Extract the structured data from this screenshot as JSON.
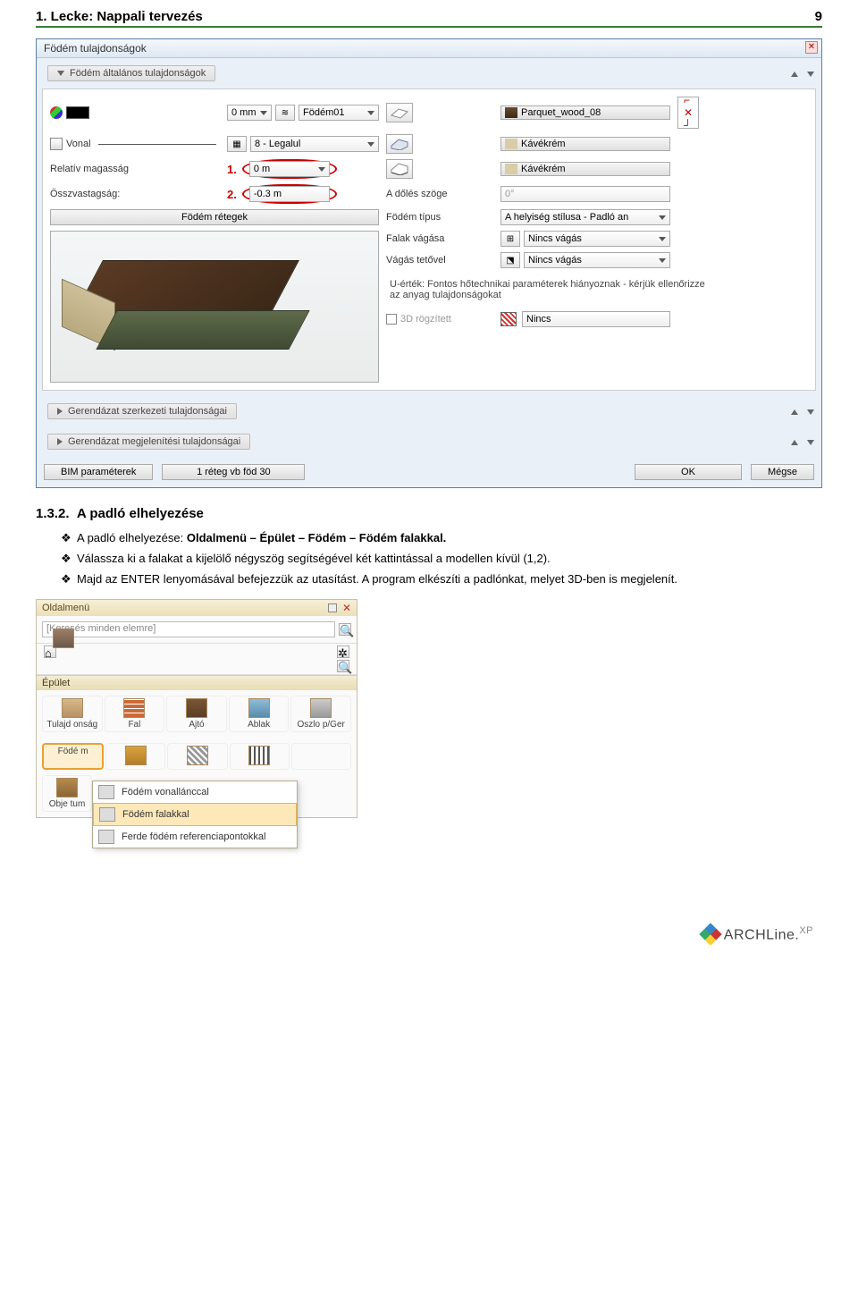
{
  "header": {
    "lesson": "1. Lecke: Nappali tervezés",
    "pagenum": "9"
  },
  "dialog": {
    "title": "Födém tulajdonságok",
    "section_general": "Födém általános tulajdonságok",
    "thickness": "0 mm",
    "name": "Födém01",
    "mat_top": "Parquet_wood_08",
    "line_label": "Vonal",
    "layer": "8 - Legalul",
    "mat_side": "Kávékrém",
    "relheight_label": "Relatív magasság",
    "relheight_val": "0 m",
    "annot1": "1.",
    "mat_bottom": "Kávékrém",
    "totalthick_label": "Összvastagság:",
    "totalthick_val": "-0.3 m",
    "annot2": "2.",
    "tilt_label": "A dőlés szöge",
    "tilt_val": "0°",
    "layers_btn": "Födém rétegek",
    "type_label": "Födém típus",
    "type_val": "A helyiség stílusa - Padló an",
    "cutwalls_label": "Falak vágása",
    "cutwalls_val": "Nincs vágás",
    "cutroof_label": "Vágás tetővel",
    "cutroof_val": "Nincs vágás",
    "uval": "U-érték: Fontos hőtechnikai paraméterek hiányoznak - kérjük ellenőrizze az anyag tulajdonságokat",
    "fixed3d": "3D rögzített",
    "nincs": "Nincs",
    "section_struct": "Gerendázat szerkezeti tulajdonságai",
    "section_disp": "Gerendázat megjelenítési tulajdonságai",
    "bim": "BIM paraméterek",
    "preset": "1 réteg vb föd 30",
    "ok": "OK",
    "cancel": "Mégse"
  },
  "body": {
    "secnum": "1.3.2.",
    "sectitle": "A padló elhelyezése",
    "b1a": "A padló elhelyezése: ",
    "b1b": "Oldalmenü – Épület – Födém – Födém falakkal.",
    "b2": "Válassza ki a falakat a kijelölő négyszög segítségével két kattintással a modellen kívül (1,2).",
    "b3": "Majd az ENTER lenyomásával befejezzük az utasítást. A program elkészíti a padlónkat, melyet 3D-ben is megjelenít."
  },
  "panel": {
    "title": "Oldalmenü",
    "search_ph": "[Keresés minden elemre]",
    "cat": "Épület",
    "items": [
      "Tulajd onság",
      "Fal",
      "Ajtó",
      "Ablak",
      "Oszlo p/Ger"
    ],
    "items2": [
      "Födé m",
      "",
      "",
      "",
      ""
    ],
    "row3_first": "Obje tum",
    "sub1": "Födém vonallánccal",
    "sub2": "Födém falakkal",
    "sub3": "Ferde födém referenciapontokkal"
  },
  "logo": {
    "brand": "ARCHLine.",
    "suffix": "XP"
  }
}
